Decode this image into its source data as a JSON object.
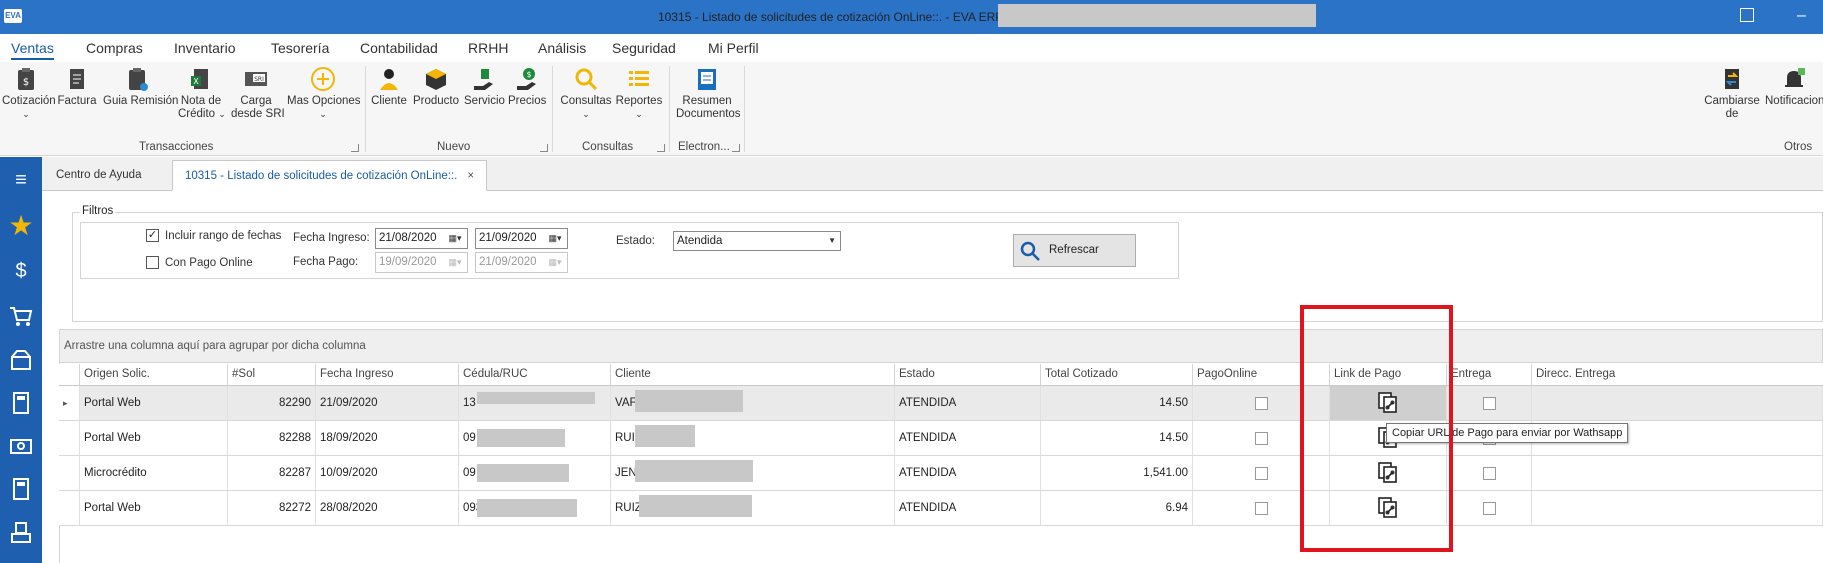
{
  "window": {
    "title": "10315 - Listado de solicitudes de cotización OnLine::. - EVA ERP ::. 20C",
    "logo": "EVA"
  },
  "menu": [
    "Ventas",
    "Compras",
    "Inventario",
    "Tesorería",
    "Contabilidad",
    "RRHH",
    "Análisis",
    "Seguridad",
    "Mi Perfil"
  ],
  "ribbon": {
    "buttons": [
      {
        "label": "Cotización",
        "icon": "clipboard-dollar-icon"
      },
      {
        "label": "Factura",
        "icon": "invoice-icon"
      },
      {
        "label": "Guia Remisión",
        "icon": "clipboard-check-icon"
      },
      {
        "label": "Nota de",
        "label2": "Crédito",
        "icon": "excel-doc-icon"
      },
      {
        "label": "Carga",
        "label2": "desde SRI",
        "icon": "sri-icon"
      },
      {
        "label": "Mas Opciones",
        "icon": "plus-circle-icon"
      },
      {
        "label": "Cliente",
        "icon": "person-icon"
      },
      {
        "label": "Producto",
        "icon": "box-icon"
      },
      {
        "label": "Servicio",
        "icon": "service-icon"
      },
      {
        "label": "Precios",
        "icon": "price-hand-icon"
      },
      {
        "label": "Consultas",
        "icon": "search-icon"
      },
      {
        "label": "Reportes",
        "icon": "list-icon"
      },
      {
        "label": "Resumen",
        "label2": "Documentos",
        "icon": "summary-doc-icon"
      },
      {
        "label": "Cambiarse",
        "label2": "de",
        "icon": "switch-icon"
      },
      {
        "label": "Notificaciones",
        "icon": "bell-icon"
      }
    ],
    "groups": [
      "Transacciones",
      "Nuevo",
      "Consultas",
      "Electron...",
      "Otros"
    ]
  },
  "tabs": {
    "help": "Centro de Ayuda",
    "active": "10315 - Listado de solicitudes de cotización OnLine::.",
    "close": "×"
  },
  "filters": {
    "legend": "Filtros",
    "include_range_label": "Incluir rango de fechas",
    "include_range_checked": "✓",
    "pago_online_label": "Con Pago Online",
    "fecha_ingreso_label": "Fecha Ingreso:",
    "fecha_ingreso_from": "21/08/2020",
    "fecha_ingreso_to": "21/09/2020",
    "fecha_pago_label": "Fecha Pago:",
    "fecha_pago_from": "19/09/2020",
    "fecha_pago_to": "21/09/2020",
    "estado_label": "Estado:",
    "estado_value": "Atendida",
    "refresh_label": "Refrescar"
  },
  "grid": {
    "group_hint": "Arrastre una columna aquí para agrupar por dicha columna",
    "columns": [
      "Origen Solic.",
      "#Sol",
      "Fecha Ingreso",
      "Cédula/RUC",
      "Cliente",
      "Estado",
      "Total Cotizado",
      "PagoOnline",
      "Link de Pago",
      "Entrega",
      "Direcc. Entrega"
    ],
    "rows": [
      {
        "origen": "Portal Web",
        "sol": "82290",
        "fecha": "21/09/2020",
        "cedula": "13",
        "cliente": "VAF",
        "estado": "ATENDIDA",
        "total": "14.50"
      },
      {
        "origen": "Portal Web",
        "sol": "82288",
        "fecha": "18/09/2020",
        "cedula": "09",
        "cliente": "RUIZ",
        "estado": "ATENDIDA",
        "total": "14.50"
      },
      {
        "origen": "Microcrédito",
        "sol": "82287",
        "fecha": "10/09/2020",
        "cedula": "09",
        "cliente": "JEN",
        "estado": "ATENDIDA",
        "total": "1,541.00"
      },
      {
        "origen": "Portal Web",
        "sol": "82272",
        "fecha": "28/08/2020",
        "cedula": "093",
        "cliente": "RUIZ",
        "estado": "ATENDIDA",
        "total": "6.94"
      }
    ],
    "row_indicator": "▸"
  },
  "tooltip": "Copiar URL de Pago para enviar por Wathsapp",
  "colors": {
    "titlebar": "#2b73c6",
    "rail": "#1f5fb0",
    "accent": "#1a5ca8",
    "highlight": "#e0141c"
  }
}
